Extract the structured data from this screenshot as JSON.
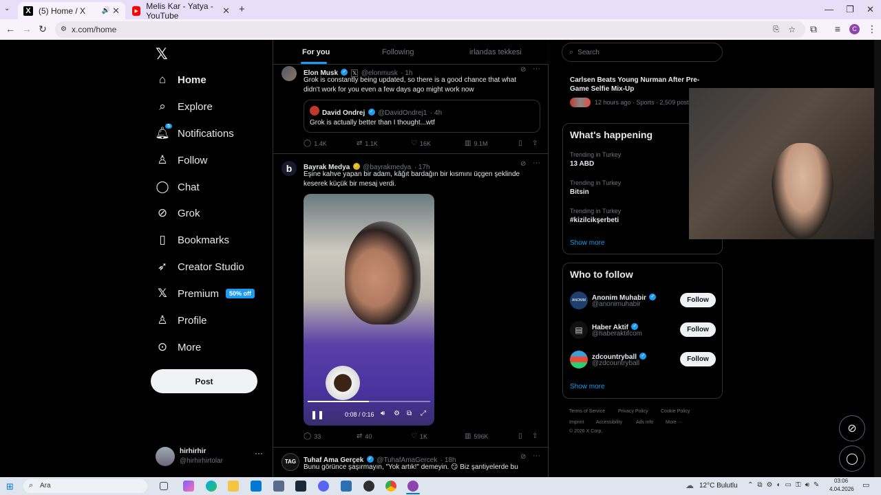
{
  "browser": {
    "tabs": [
      {
        "title": "(5) Home / X",
        "active": true
      },
      {
        "title": "Melis Kar - Yatya - YouTube",
        "active": false
      }
    ],
    "url": "x.com/home",
    "profile_initial": "C"
  },
  "nav": {
    "items": [
      {
        "label": "Home",
        "icon": "home-icon"
      },
      {
        "label": "Explore",
        "icon": "search-icon"
      },
      {
        "label": "Notifications",
        "icon": "bell-icon",
        "badge": "5"
      },
      {
        "label": "Follow",
        "icon": "person-add-icon"
      },
      {
        "label": "Chat",
        "icon": "chat-icon"
      },
      {
        "label": "Grok",
        "icon": "grok-icon"
      },
      {
        "label": "Bookmarks",
        "icon": "bookmark-icon"
      },
      {
        "label": "Creator Studio",
        "icon": "rocket-icon"
      },
      {
        "label": "Premium",
        "icon": "x-logo-icon",
        "badge": "50% off"
      },
      {
        "label": "Profile",
        "icon": "person-icon"
      },
      {
        "label": "More",
        "icon": "more-circle-icon"
      }
    ],
    "post_label": "Post",
    "account": {
      "name": "hirhirhir",
      "handle": "@hirhirhirtolar"
    }
  },
  "feed": {
    "tabs": [
      "For you",
      "Following",
      "irlandas tekkesi"
    ],
    "tweets": [
      {
        "name": "Elon Musk",
        "handle": "@elonmusk",
        "time": "· 1h",
        "text": "Grok is constantly being updated, so there is a good chance that what didn't work for you even a few days ago might work now",
        "quote": {
          "name": "David Ondrej",
          "handle": "@DavidOndrej1",
          "time": "· 4h",
          "text": "Grok is actually better than I thought...wtf"
        },
        "replies": "1.4K",
        "reposts": "1.1K",
        "likes": "16K",
        "views": "9.1M"
      },
      {
        "name": "Bayrak Medya",
        "handle": "@bayrakmedya",
        "time": "· 17h",
        "text": "Eşine kahve yapan bir adam, kâğıt bardağın bir kısmını üçgen şeklinde keserek küçük bir mesaj verdi.",
        "video_time": "0:08 / 0:16",
        "video_progress": 0.5,
        "replies": "33",
        "reposts": "40",
        "likes": "1K",
        "views": "596K"
      },
      {
        "name": "Tuhaf Ama Gerçek",
        "handle": "@TuhafAmaGercek",
        "time": "· 18h",
        "text": "Bunu görünce şaşırmayın, \"Yok artık!\" demeyin. 😏 Biz şantiyelerde bu"
      }
    ]
  },
  "right": {
    "search_placeholder": "Search",
    "top_news": {
      "title": "Carlsen Beats Young Nurman After Pre-Game Selfie Mix-Up",
      "meta": "12 hours ago · Sports · 2,509 posts"
    },
    "happening_title": "What's happening",
    "trends": [
      {
        "context": "Trending in Turkey",
        "name": "13 ABD"
      },
      {
        "context": "Trending in Turkey",
        "name": "Bitsin"
      },
      {
        "context": "Trending in Turkey",
        "name": "#kizilcikşerbeti"
      }
    ],
    "show_more": "Show more",
    "who_title": "Who to follow",
    "follow_label": "Follow",
    "suggestions": [
      {
        "name": "Anonim Muhabir",
        "handle": "@anonimuhabir"
      },
      {
        "name": "Haber Aktif",
        "handle": "@haberaktifcom"
      },
      {
        "name": "zdcountryball",
        "handle": "@zdcountryball"
      }
    ],
    "footer": [
      "Terms of Service",
      "Privacy Policy",
      "Cookie Policy",
      "Imprint",
      "Accessibility",
      "Ads info",
      "More ···",
      "© 2026 X Corp."
    ]
  },
  "taskbar": {
    "search": "Ara",
    "weather": "12°C  Bulutlu",
    "time": "03:06",
    "date": "4.04.2026"
  },
  "colors": {
    "accent": "#1d9bf0",
    "background": "#000000",
    "border": "#2f3336"
  }
}
